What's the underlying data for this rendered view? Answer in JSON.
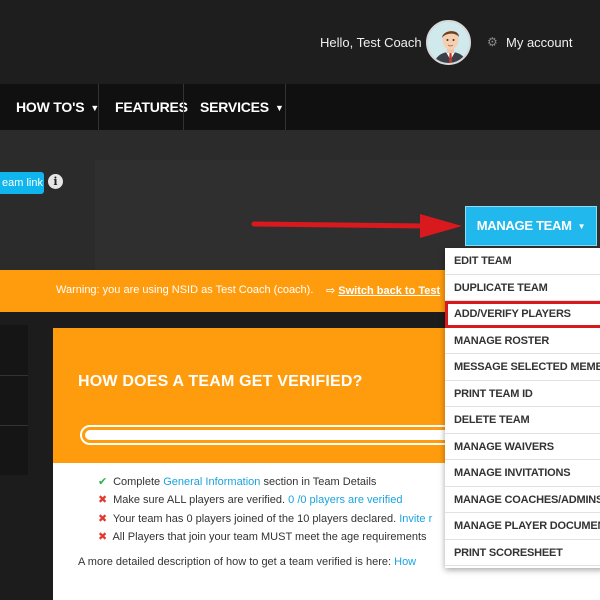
{
  "header": {
    "greeting": "Hello, Test Coach",
    "account_label": "My account",
    "account_icon": "gear-icon"
  },
  "nav": {
    "items": [
      {
        "label": "HOW TO'S",
        "has_dropdown": true
      },
      {
        "label": "FEATURES",
        "has_dropdown": false
      },
      {
        "label": "SERVICES",
        "has_dropdown": true
      }
    ]
  },
  "team_link": {
    "label": "eam link",
    "info_icon": "info-icon"
  },
  "manage_team": {
    "label": "MANAGE TEAM",
    "color": "#21b8ee"
  },
  "dropdown": {
    "items": [
      {
        "label": "EDIT TEAM"
      },
      {
        "label": "DUPLICATE TEAM"
      },
      {
        "label": "ADD/VERIFY PLAYERS",
        "highlighted": true
      },
      {
        "label": "MANAGE ROSTER"
      },
      {
        "label": "MESSAGE SELECTED MEMBERS"
      },
      {
        "label": "PRINT TEAM ID"
      },
      {
        "label": "DELETE TEAM"
      },
      {
        "label": "MANAGE WAIVERS"
      },
      {
        "label": "MANAGE INVITATIONS"
      },
      {
        "label": "MANAGE COACHES/ADMINS"
      },
      {
        "label": "MANAGE PLAYER DOCUMENTS"
      },
      {
        "label": "PRINT SCORESHEET"
      }
    ],
    "highlight_color": "#d8191e"
  },
  "warning": {
    "text": "Warning: you are using NSID as Test Coach (coach).",
    "switch_icon": "sign-out-icon",
    "switch_label": "Switch back to Test",
    "color": "#ff9c0e"
  },
  "verify": {
    "title": "HOW DOES A TEAM GET VERIFIED?",
    "progress": 1.0,
    "checklist": [
      {
        "status": "ok",
        "before": "Complete ",
        "link": "General Information",
        "after": " section in Team Details"
      },
      {
        "status": "bad",
        "before": "Make sure ALL players are verified. ",
        "link": "0 /0 players are verified",
        "after": ""
      },
      {
        "status": "bad",
        "before": "Your team has 0 players joined of the 10 players declared. ",
        "link": "Invite r",
        "after": ""
      },
      {
        "status": "bad",
        "before": "All Players that join your team MUST meet the age requirements",
        "link": "",
        "after": ""
      }
    ],
    "description": "A more detailed description of how to get a team verified is here: ",
    "description_link": "How"
  }
}
